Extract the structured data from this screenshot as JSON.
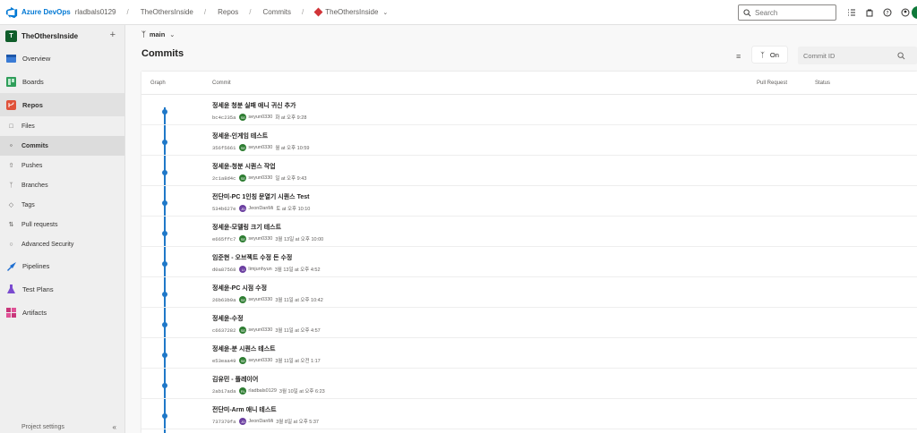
{
  "topbar": {
    "brand": "Azure DevOps",
    "org": "rladbals0129",
    "breadcrumbs": [
      "TheOthersInside",
      "Repos",
      "Commits"
    ],
    "repo": "TheOthersInside",
    "search_placeholder": "Search"
  },
  "sidebar": {
    "project_initial": "T",
    "project_name": "TheOthersInside",
    "items": [
      {
        "label": "Overview"
      },
      {
        "label": "Boards"
      },
      {
        "label": "Repos"
      }
    ],
    "repo_subitems": [
      {
        "label": "Files"
      },
      {
        "label": "Commits"
      },
      {
        "label": "Pushes"
      },
      {
        "label": "Branches"
      },
      {
        "label": "Tags"
      },
      {
        "label": "Pull requests"
      },
      {
        "label": "Advanced Security"
      }
    ],
    "bottom_items": [
      {
        "label": "Pipelines"
      },
      {
        "label": "Test Plans"
      },
      {
        "label": "Artifacts"
      }
    ],
    "footer_label": "Project settings"
  },
  "main": {
    "branch": "main",
    "title": "Commits",
    "toggle_label": "On",
    "commit_search_placeholder": "Commit ID",
    "columns": [
      "Graph",
      "Commit",
      "Pull Request",
      "Status"
    ]
  },
  "commits": [
    {
      "message": "정세윤 청분 실패 애니 귀신 추가",
      "hash": "bc4c235a",
      "author": "seyun0330",
      "date": "화 at 오후 9:28",
      "avatar_color": "#2e7d32",
      "avatar_initials": "SE"
    },
    {
      "message": "정세윤-인게임 테스트",
      "hash": "356f5661",
      "author": "seyun0330",
      "date": "월 at 오후 10:59",
      "avatar_color": "#2e7d32",
      "avatar_initials": "SE"
    },
    {
      "message": "정세윤-청분 시퀀스 작업",
      "hash": "2c1a8d4c",
      "author": "seyun0330",
      "date": "일 at 오후 9:43",
      "avatar_color": "#2e7d32",
      "avatar_initials": "SE"
    },
    {
      "message": "전단미-PC 1인칭 문열기 시퀀스 Test",
      "hash": "534b627e",
      "author": "JeonDanMi",
      "date": "토 at 오후 10:10",
      "avatar_color": "#6b3fa0",
      "avatar_initials": "JD"
    },
    {
      "message": "정세윤-모델링 크기 테스트",
      "hash": "e665ffc7",
      "author": "seyun0330",
      "date": "3월 13일 at 오후 10:00",
      "avatar_color": "#2e7d32",
      "avatar_initials": "SE"
    },
    {
      "message": "임준현 - 오브젝트 수정 돈 수정",
      "hash": "d0a87568",
      "author": "limjunhyun",
      "date": "3월 13일 at 오후 4:52",
      "avatar_color": "#6b3fa0",
      "avatar_initials": "LI"
    },
    {
      "message": "정세윤-PC 시점 수정",
      "hash": "26b63b9a",
      "author": "seyun0330",
      "date": "3월 11일 at 오후 10:42",
      "avatar_color": "#2e7d32",
      "avatar_initials": "SE"
    },
    {
      "message": "정세윤-수정",
      "hash": "c6637282",
      "author": "seyun0330",
      "date": "3월 11일 at 오후 4:57",
      "avatar_color": "#2e7d32",
      "avatar_initials": "SE"
    },
    {
      "message": "정세윤-분 시퀀스 테스트",
      "hash": "e53eaa49",
      "author": "seyun0330",
      "date": "3월 11일 at 오전 1:17",
      "avatar_color": "#2e7d32",
      "avatar_initials": "SE"
    },
    {
      "message": "김유민 - 플레이어",
      "hash": "2ab17ada",
      "author": "rladbals0129",
      "date": "3월 10일 at 오후 6:23",
      "avatar_color": "#2e7d32",
      "avatar_initials": "RL"
    },
    {
      "message": "전단미-Arm 애니 테스트",
      "hash": "737370fa",
      "author": "JeonDanMi",
      "date": "3월 8일 at 오후 5:37",
      "avatar_color": "#6b3fa0",
      "avatar_initials": "JD"
    }
  ]
}
